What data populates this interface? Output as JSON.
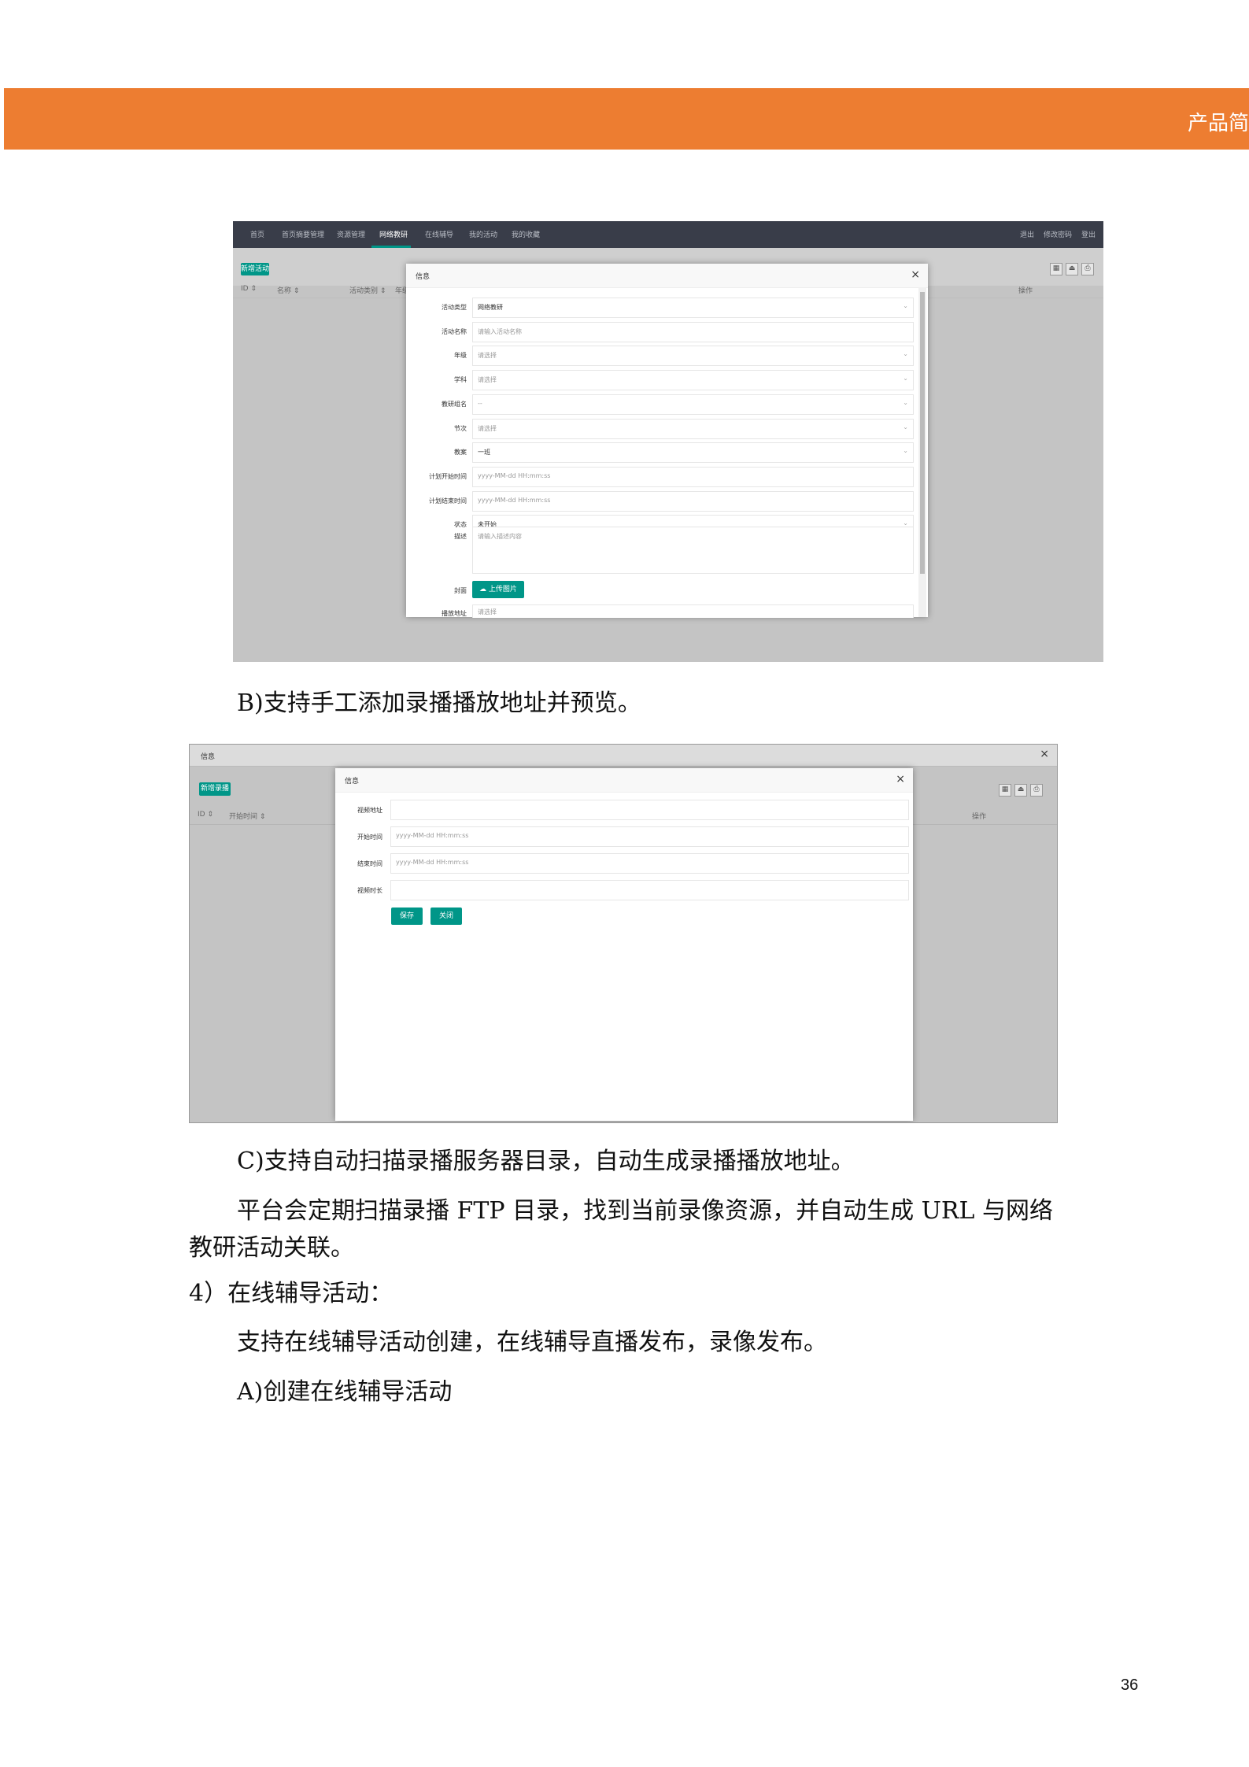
{
  "header": {
    "title": "产品简"
  },
  "shot1": {
    "nav": [
      "首页",
      "首页摘要管理",
      "资源管理",
      "网络教研",
      "在线辅导",
      "我的活动",
      "我的收藏"
    ],
    "nav_active_index": 3,
    "nav_right": [
      "退出",
      "修改密码",
      "登出"
    ],
    "add_button": "新增活动",
    "columns": [
      "ID ⇕",
      "名称 ⇕",
      "活动类别 ⇕",
      "年级"
    ],
    "op_column": "操作",
    "modal": {
      "title": "信息",
      "fields": [
        {
          "label": "活动类型",
          "value": "网络教研",
          "placeholder": "",
          "dropdown": true
        },
        {
          "label": "活动名称",
          "value": "",
          "placeholder": "请输入活动名称",
          "dropdown": false
        },
        {
          "label": "年级",
          "value": "",
          "placeholder": "请选择",
          "dropdown": true
        },
        {
          "label": "学科",
          "value": "",
          "placeholder": "请选择",
          "dropdown": true
        },
        {
          "label": "教研组名",
          "value": "",
          "placeholder": "--",
          "dropdown": true
        },
        {
          "label": "节次",
          "value": "",
          "placeholder": "请选择",
          "dropdown": true
        },
        {
          "label": "教案",
          "value": "一班",
          "placeholder": "",
          "dropdown": true
        },
        {
          "label": "计划开始时间",
          "value": "",
          "placeholder": "yyyy-MM-dd HH:mm:ss",
          "dropdown": false
        },
        {
          "label": "计划结束时间",
          "value": "",
          "placeholder": "yyyy-MM-dd HH:mm:ss",
          "dropdown": false
        },
        {
          "label": "状态",
          "value": "未开始",
          "placeholder": "",
          "dropdown": true
        }
      ],
      "desc_label": "描述",
      "desc_placeholder": "请输入描述内容",
      "cover_label": "封面",
      "upload_button": "上传图片",
      "last_label": "播放地址",
      "last_placeholder": "请选择"
    }
  },
  "caption_b": "B)支持手工添加录播播放地址并预览。",
  "shot2": {
    "outer_title": "信息",
    "add_button": "新增录播",
    "columns": [
      "ID ⇕",
      "开始时间 ⇕"
    ],
    "op_column": "操作",
    "modal": {
      "title": "信息",
      "fields": [
        {
          "label": "视频地址",
          "placeholder": ""
        },
        {
          "label": "开始时间",
          "placeholder": "yyyy-MM-dd HH:mm:ss"
        },
        {
          "label": "结束时间",
          "placeholder": "yyyy-MM-dd HH:mm:ss"
        },
        {
          "label": "视频时长",
          "placeholder": ""
        }
      ],
      "save_button": "保存",
      "close_button": "关闭"
    }
  },
  "caption_c": "C)支持自动扫描录播服务器目录，自动生成录播播放地址。",
  "para_ftp_1": "平台会定期扫描录播 FTP 目录，找到当前录像资源，并自动生成 URL 与网络",
  "para_ftp_2": "教研活动关联。",
  "heading_4": "4）在线辅导活动：",
  "para_support": "支持在线辅导活动创建，在线辅导直播发布，录像发布。",
  "caption_a": "A)创建在线辅导活动",
  "page_number": "36",
  "colors": {
    "header_orange": "#ed7d31",
    "accent_green": "#009688",
    "nav_dark": "#393d49"
  }
}
